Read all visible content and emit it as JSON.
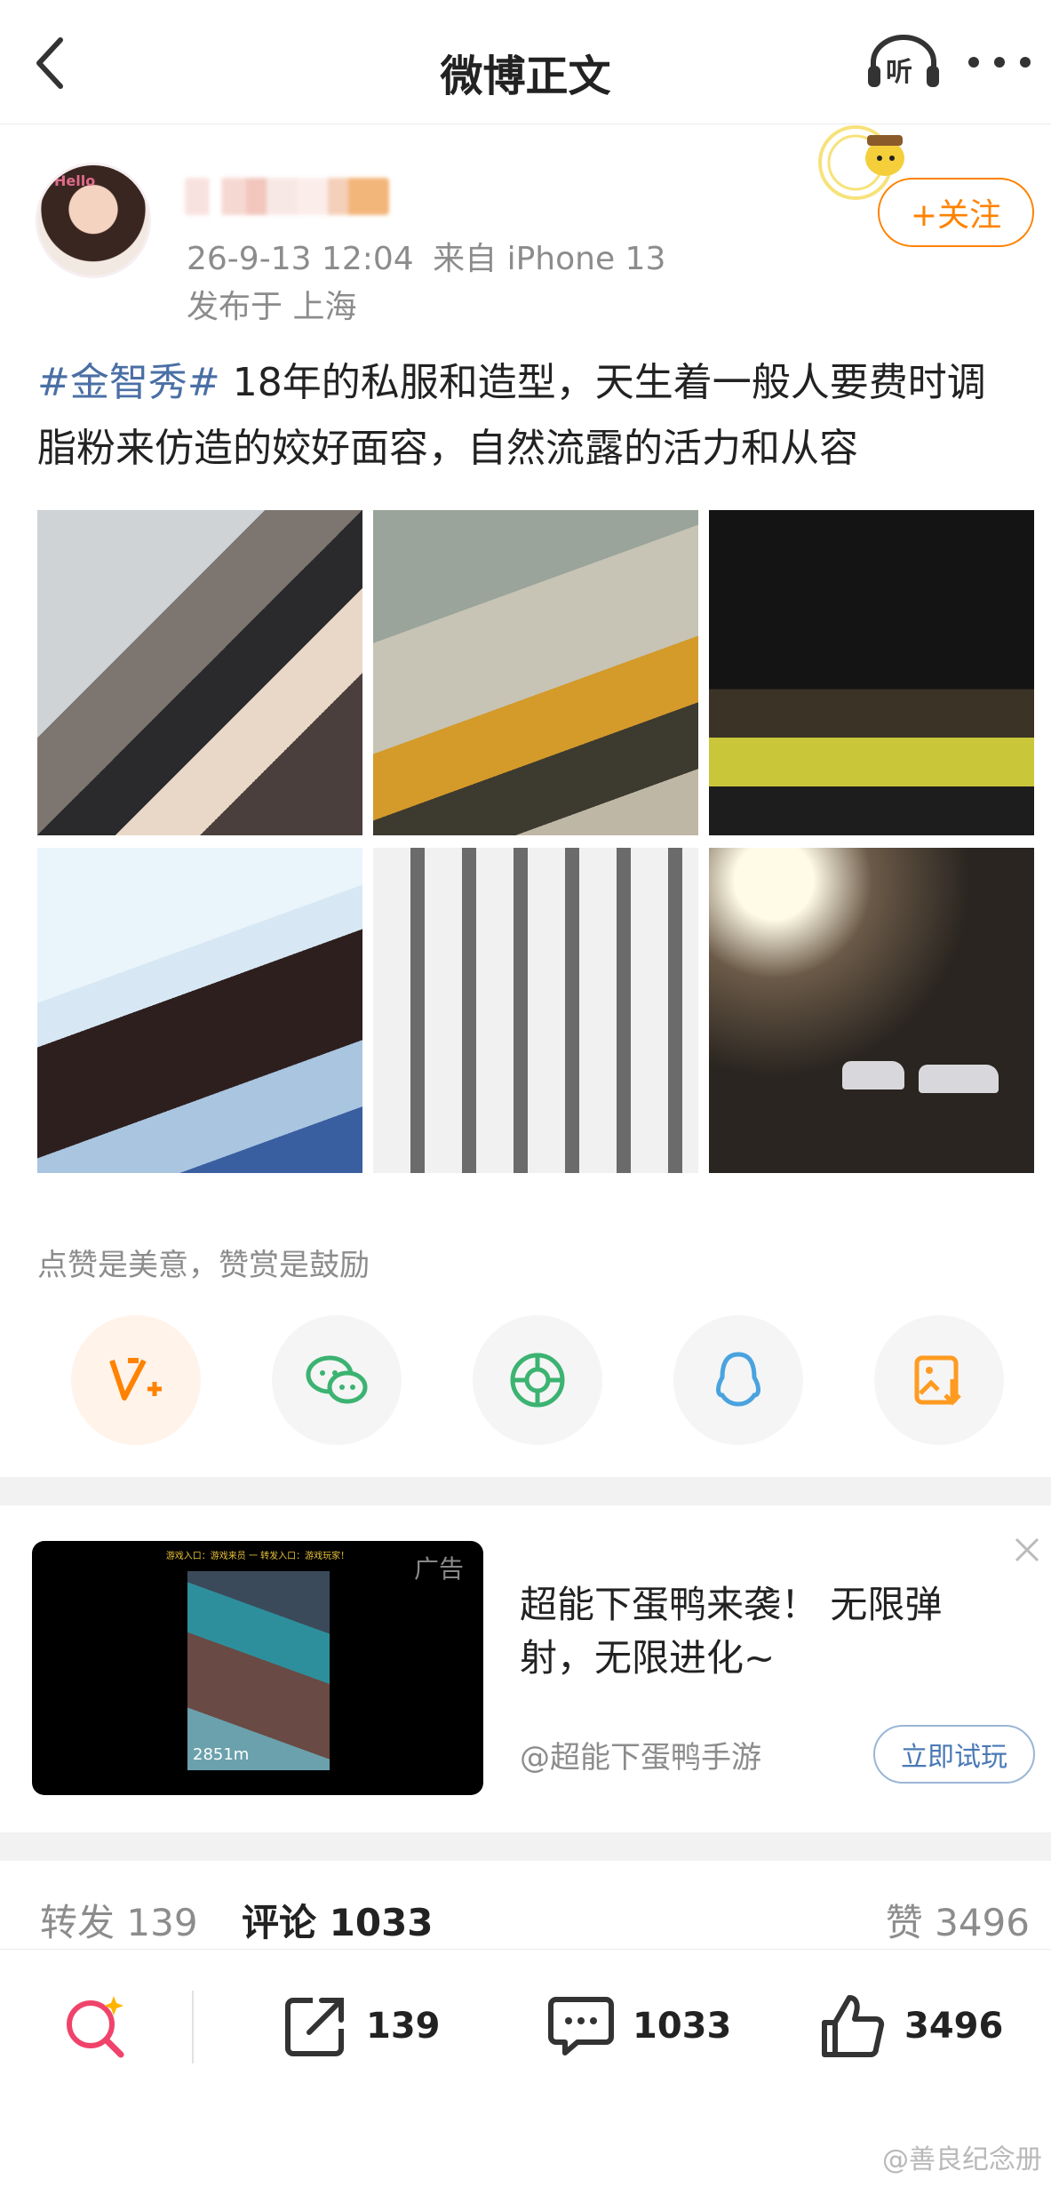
{
  "header": {
    "title": "微博正文",
    "listen_label": "听"
  },
  "post": {
    "avatar_tag": "Hello",
    "timestamp": "26-9-13 12:04",
    "source": "来自 iPhone 13",
    "location": "发布于 上海",
    "follow_label": "+关注",
    "hashtag": "#金智秀#",
    "text": " 18年的私服和造型，天生着一般人要费时调脂粉来仿造的姣好面容，自然流露的活力和从容"
  },
  "reward": {
    "hint": "点赞是美意，赞赏是鼓励",
    "share_targets": [
      {
        "icon": "v-plus-icon",
        "color": "#ff8200"
      },
      {
        "icon": "wechat-icon",
        "color": "#3cb371"
      },
      {
        "icon": "moments-icon",
        "color": "#3cb371"
      },
      {
        "icon": "qq-icon",
        "color": "#4aa3df"
      },
      {
        "icon": "save-image-icon",
        "color": "#ff9b21"
      }
    ]
  },
  "ad": {
    "label": "广告",
    "top_text": "游戏入口：游戏来员 一 转发入口：游戏玩家！",
    "score": "2851m",
    "title": "超能下蛋鸭来袭！ 无限弹射，无限进化~",
    "source": "@超能下蛋鸭手游",
    "cta": "立即试玩"
  },
  "stats": {
    "repost_label": "转发",
    "repost_count": "139",
    "comment_label": "评论",
    "comment_count": "1033",
    "like_label": "赞",
    "like_count": "3496"
  },
  "bottombar": {
    "repost_count": "139",
    "comment_count": "1033",
    "like_count": "3496"
  },
  "watermark": "@善良纪念册",
  "colors": {
    "accent": "#ff8200",
    "link": "#4a6fa5",
    "muted": "#8c8c8c"
  }
}
